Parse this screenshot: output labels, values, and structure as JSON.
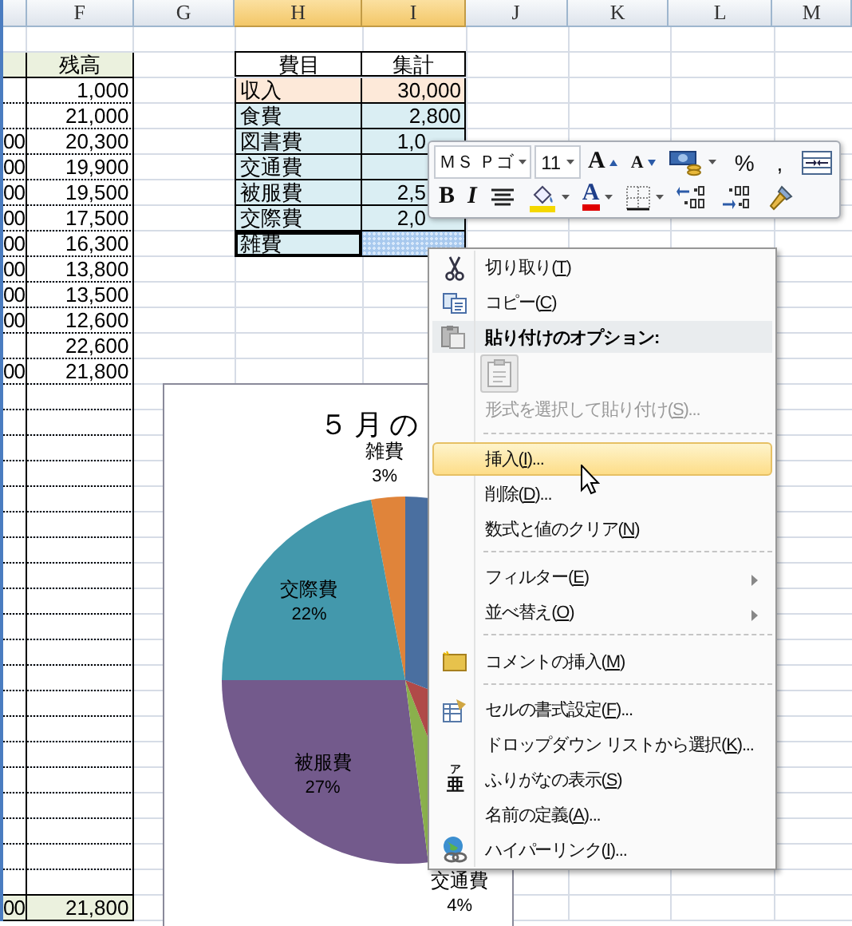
{
  "columns": [
    {
      "label": "F",
      "selected": false
    },
    {
      "label": "G",
      "selected": false
    },
    {
      "label": "H",
      "selected": true
    },
    {
      "label": "I",
      "selected": true
    },
    {
      "label": "J",
      "selected": false
    },
    {
      "label": "K",
      "selected": false
    },
    {
      "label": "L",
      "selected": false
    },
    {
      "label": "M",
      "selected": false
    }
  ],
  "ledger": {
    "header": "残高",
    "rows": [
      {
        "balance": "1,000"
      },
      {
        "balance": "21,000"
      },
      {
        "col_e": "00",
        "balance": "20,300"
      },
      {
        "col_e": "00",
        "balance": "19,900"
      },
      {
        "col_e": "00",
        "balance": "19,500"
      },
      {
        "col_e": "00",
        "balance": "17,500"
      },
      {
        "col_e": "00",
        "balance": "16,300"
      },
      {
        "col_e": "00",
        "balance": "13,800"
      },
      {
        "col_e": "00",
        "balance": "13,500"
      },
      {
        "col_e": "00",
        "balance": "12,600"
      },
      {
        "balance": "22,600"
      },
      {
        "col_e": "00",
        "balance": "21,800"
      }
    ],
    "total": {
      "col_e": "00",
      "balance": "21,800"
    }
  },
  "summary": {
    "headers": [
      "費目",
      "集計"
    ],
    "rows": [
      {
        "kind": "income",
        "item": "収入",
        "total": "30,000",
        "cut": false,
        "selected": false
      },
      {
        "kind": "expense",
        "item": "食費",
        "total": "2,800",
        "cut": false,
        "selected": false
      },
      {
        "kind": "expense",
        "item": "図書費",
        "total": "1,0",
        "cut": true,
        "selected": false
      },
      {
        "kind": "expense",
        "item": "交通費",
        "selected": false
      },
      {
        "kind": "expense",
        "item": "被服費",
        "total": "2,5",
        "cut": true,
        "selected": false
      },
      {
        "kind": "expense",
        "item": "交際費",
        "total": "2,0",
        "cut": true,
        "selected": false
      },
      {
        "kind": "expense",
        "item": "雑費",
        "cut": false,
        "selected": true
      }
    ]
  },
  "chart": {
    "title": "５月の",
    "slices": [
      {
        "color": "#e0843a",
        "label": "雑費",
        "percent": "3%"
      },
      {
        "color": "#4398ac",
        "label": "交際費",
        "percent": "22%"
      },
      {
        "color": "#735a8c",
        "label": "被服費",
        "percent": "27%"
      },
      {
        "color": "#8ab04c",
        "label": "交通費",
        "percent": "4%"
      },
      {
        "color": "#b04a48"
      },
      {
        "color": "#4a6fa0"
      }
    ]
  },
  "mini_toolbar": {
    "font": {
      "text": "ＭＳ Ｐゴ",
      "dropdown": true
    },
    "size": {
      "text": "11",
      "dropdown": true
    },
    "top_buttons": [
      {
        "kind": "grow",
        "text": "A",
        "dropdown": false
      },
      {
        "kind": "shrink",
        "text": "A",
        "dropdown": false
      },
      {
        "kind": "accounting",
        "dropdown": true
      },
      {
        "kind": "percent",
        "text": "%",
        "dropdown": false
      },
      {
        "kind": "comma",
        "text": ",",
        "dropdown": false
      },
      {
        "kind": "merge",
        "dropdown": false
      }
    ],
    "bottom_buttons": [
      {
        "kind": "bold",
        "text": "B",
        "dropdown": false
      },
      {
        "kind": "italic",
        "text": "I",
        "dropdown": false
      },
      {
        "kind": "center",
        "dropdown": false
      },
      {
        "kind": "fill",
        "dropdown": true
      },
      {
        "kind": "font-color",
        "text": "A",
        "dropdown": true
      },
      {
        "kind": "borders",
        "dropdown": true
      },
      {
        "kind": "inc-decimal",
        "dropdown": false
      },
      {
        "kind": "dec-decimal",
        "dropdown": false
      },
      {
        "kind": "painter",
        "dropdown": false
      }
    ]
  },
  "context_menu": {
    "items": [
      {
        "kind": "item",
        "before": "切り取り(",
        "key": "T",
        "after": ")",
        "selected": false,
        "disabled": false,
        "submenu": false
      },
      {
        "kind": "item",
        "before": "コピー(",
        "key": "C",
        "after": ")",
        "selected": false,
        "disabled": false,
        "submenu": false
      },
      {
        "kind": "header",
        "text": "貼り付けのオプション:"
      },
      {
        "kind": "paste-options"
      },
      {
        "kind": "item",
        "before": "形式を選択して貼り付け(",
        "key": "S",
        "after": ")...",
        "selected": false,
        "disabled": true,
        "submenu": false
      },
      {
        "kind": "separator"
      },
      {
        "kind": "item",
        "before": "挿入(",
        "key": "I",
        "after": ")...",
        "selected": true,
        "disabled": false,
        "submenu": false
      },
      {
        "kind": "item",
        "before": "削除(",
        "key": "D",
        "after": ")...",
        "selected": false,
        "disabled": false,
        "submenu": false
      },
      {
        "kind": "item",
        "before": "数式と値のクリア(",
        "key": "N",
        "after": ")",
        "selected": false,
        "disabled": false,
        "submenu": false
      },
      {
        "kind": "separator"
      },
      {
        "kind": "item",
        "before": "フィルター(",
        "key": "E",
        "after": ")",
        "selected": false,
        "disabled": false,
        "submenu": true
      },
      {
        "kind": "item",
        "before": "並べ替え(",
        "key": "O",
        "after": ")",
        "selected": false,
        "disabled": false,
        "submenu": true
      },
      {
        "kind": "separator"
      },
      {
        "kind": "item",
        "before": "コメントの挿入(",
        "key": "M",
        "after": ")",
        "selected": false,
        "disabled": false,
        "submenu": false
      },
      {
        "kind": "separator"
      },
      {
        "kind": "item",
        "before": "セルの書式設定(",
        "key": "F",
        "after": ")...",
        "selected": false,
        "disabled": false,
        "submenu": false
      },
      {
        "kind": "item",
        "before": "ドロップダウン リストから選択(",
        "key": "K",
        "after": ")...",
        "selected": false,
        "disabled": false,
        "submenu": false
      },
      {
        "kind": "item",
        "glyph_top": "ア",
        "glyph": "亜",
        "before": "ふりがなの表示(",
        "key": "S",
        "after": ")",
        "selected": false,
        "disabled": false,
        "submenu": false
      },
      {
        "kind": "item",
        "before": "名前の定義(",
        "key": "A",
        "after": ")...",
        "selected": false,
        "disabled": false,
        "submenu": false
      },
      {
        "kind": "item",
        "before": "ハイパーリンク(",
        "key": "I",
        "after": ")...",
        "selected": false,
        "disabled": false,
        "submenu": false
      }
    ]
  }
}
